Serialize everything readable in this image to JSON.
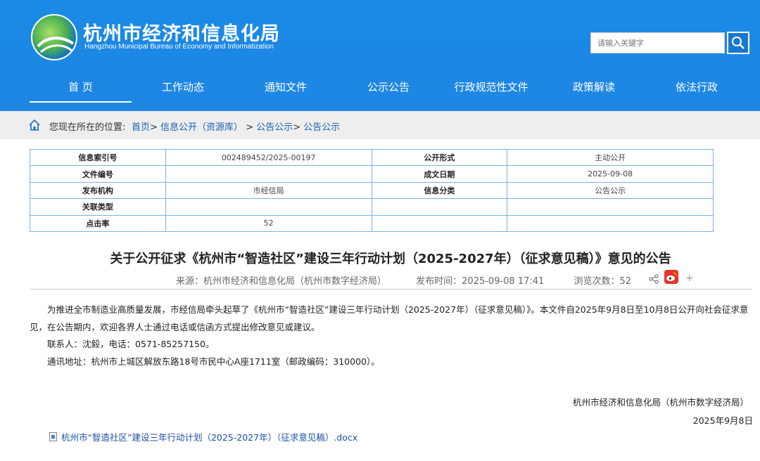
{
  "header": {
    "org_name": "杭州市经济和信息化局",
    "org_name_en": "Hangzhou Municipal Bureau of Economy and Informatization",
    "search_placeholder": "请输入关键字"
  },
  "nav": [
    {
      "label": "首 页"
    },
    {
      "label": "工作动态"
    },
    {
      "label": "通知文件"
    },
    {
      "label": "公示公告"
    },
    {
      "label": "行政规范性文件"
    },
    {
      "label": "政策解读"
    },
    {
      "label": "依法行政"
    }
  ],
  "breadcrumb": {
    "prefix": "您现在所在的位置:",
    "items": [
      "首页",
      "信息公开（资源库）",
      "公告公示",
      "公告公示"
    ]
  },
  "info_table": {
    "rows": [
      [
        "信息索引号",
        "002489452/2025-00197",
        "公开形式",
        "主动公开"
      ],
      [
        "文件编号",
        "",
        "成文日期",
        "2025-09-08"
      ],
      [
        "发布机构",
        "市经信局",
        "信息分类",
        "公告公示"
      ],
      [
        "关联类型",
        "",
        "",
        ""
      ],
      [
        "点击率",
        "52",
        "",
        ""
      ]
    ]
  },
  "article": {
    "title": "关于公开征求《杭州市“智造社区”建设三年行动计划（2025-2027年）（征求意见稿）》意见的公告",
    "source": "来源：杭州市经济和信息化局（杭州市数字经济局）",
    "publish_time": "发布时间：2025-09-08 17:41",
    "views": "浏览次数：52",
    "paragraphs": [
      "为推进全市制造业高质量发展，市经信局牵头起草了《杭州市“智造社区”建设三年行动计划（2025-2027年）（征求意见稿）》。本文件自2025年9月8日至10月8日公开向社会征求意见，在公告期内，欢迎各界人士通过电话或信函方式提出修改意见或建议。",
      "联系人：沈毅，电话：0571-85257150。",
      "通讯地址：杭州市上城区解放东路18号市民中心A座1711室（邮政编码：310000）。"
    ],
    "signature_org": "杭州市经济和信息化局（杭州市数字经济局）",
    "signature_date": "2025年9月8日",
    "attachment": "杭州市“智造社区”建设三年行动计划（2025-2027年）（征求意见稿）.docx",
    "plus": "+"
  }
}
